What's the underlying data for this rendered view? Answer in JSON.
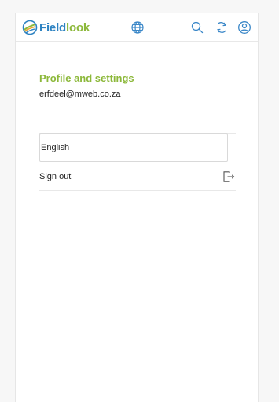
{
  "colors": {
    "brand_blue": "#2e83c2",
    "brand_green": "#8cb83a",
    "icon_blue": "#3a87c8",
    "text": "#222222"
  },
  "header": {
    "logo_part1": "Field",
    "logo_part2": "look",
    "icons": [
      "globe-icon",
      "search-icon",
      "sync-icon",
      "user-circle-icon"
    ]
  },
  "profile": {
    "title": "Profile and settings",
    "email": "erfdeel@mweb.co.za"
  },
  "settings": {
    "language_value": "English",
    "sign_out_label": "Sign out",
    "sign_out_icon": "sign-out-icon"
  }
}
